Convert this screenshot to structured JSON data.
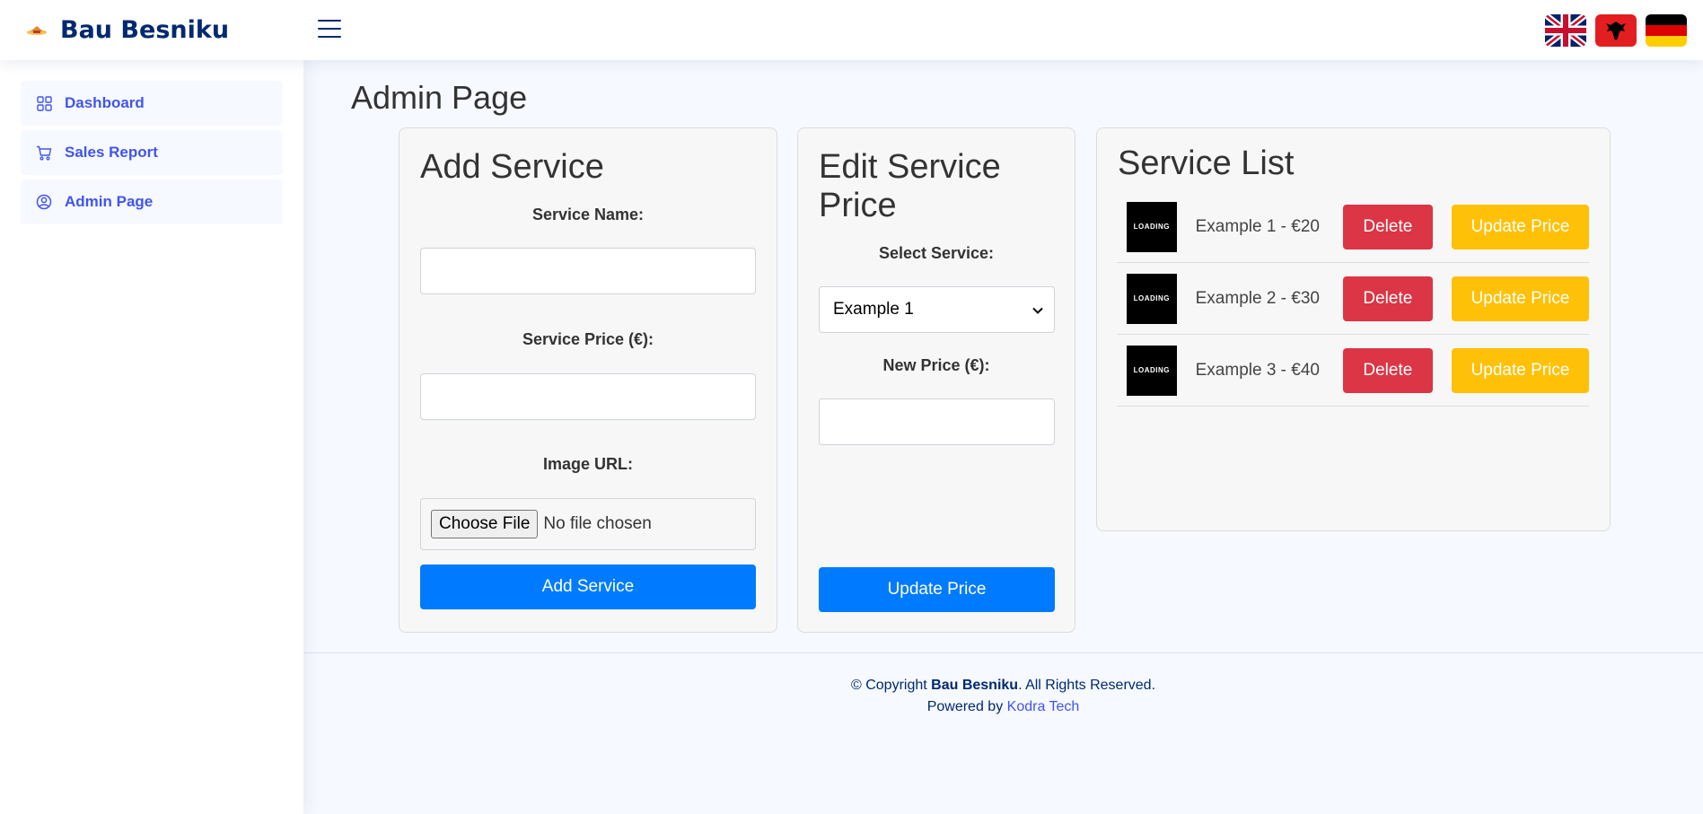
{
  "header": {
    "brand": "Bau Besniku",
    "flags": [
      {
        "name": "english-flag"
      },
      {
        "name": "albanian-flag"
      },
      {
        "name": "german-flag"
      }
    ]
  },
  "sidebar": {
    "items": [
      {
        "label": "Dashboard",
        "icon": "grid-icon"
      },
      {
        "label": "Sales Report",
        "icon": "cart-icon"
      },
      {
        "label": "Admin Page",
        "icon": "person-circle-icon"
      }
    ]
  },
  "main": {
    "page_title": "Admin Page",
    "add_service": {
      "title": "Add Service",
      "name_label": "Service Name:",
      "name_value": "",
      "price_label": "Service Price (€):",
      "price_value": "",
      "image_label": "Image URL:",
      "file_button": "Choose File",
      "file_status": "No file chosen",
      "submit_label": "Add Service"
    },
    "edit_price": {
      "title": "Edit Service Price",
      "select_label": "Select Service:",
      "selected_service": "Example 1",
      "new_price_label": "New Price (€):",
      "new_price_value": "",
      "submit_label": "Update Price"
    },
    "service_list": {
      "title": "Service List",
      "thumb_text": "LOADING",
      "delete_label": "Delete",
      "update_label": "Update Price",
      "items": [
        {
          "text": "Example 1 - €20"
        },
        {
          "text": "Example 2 - €30"
        },
        {
          "text": "Example 3 - €40"
        }
      ]
    }
  },
  "footer": {
    "copyright_prefix": "© Copyright ",
    "copyright_brand": "Bau Besniku",
    "copyright_suffix": ". All Rights Reserved.",
    "powered_prefix": "Powered by ",
    "powered_link": "Kodra Tech"
  },
  "colors": {
    "brand": "#012970",
    "accent": "#4154f1",
    "primary": "#007bff",
    "danger": "#dc3545",
    "warning": "#ffc107"
  }
}
